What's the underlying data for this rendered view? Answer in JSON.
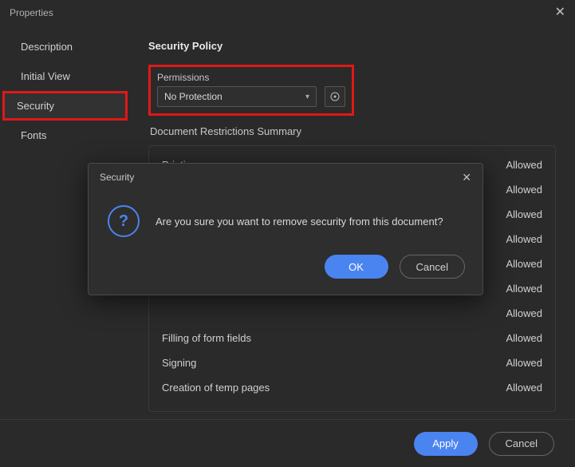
{
  "window": {
    "title": "Properties"
  },
  "sidebar": {
    "items": [
      {
        "label": "Description"
      },
      {
        "label": "Initial View"
      },
      {
        "label": "Security"
      },
      {
        "label": "Fonts"
      }
    ]
  },
  "security": {
    "title": "Security Policy",
    "permissions_label": "Permissions",
    "permissions_value": "No Protection",
    "summary_title": "Document Restrictions Summary",
    "rows": [
      {
        "label": "Printing",
        "status": "Allowed"
      },
      {
        "label": "",
        "status": "Allowed"
      },
      {
        "label": "",
        "status": "Allowed"
      },
      {
        "label": "",
        "status": "Allowed"
      },
      {
        "label": "",
        "status": "Allowed"
      },
      {
        "label": "",
        "status": "Allowed"
      },
      {
        "label": "",
        "status": "Allowed"
      },
      {
        "label": "Filling of form fields",
        "status": "Allowed"
      },
      {
        "label": "Signing",
        "status": "Allowed"
      },
      {
        "label": "Creation of temp pages",
        "status": "Allowed"
      }
    ]
  },
  "modal": {
    "title": "Security",
    "message": "Are you sure you want to remove security from this document?",
    "ok": "OK",
    "cancel": "Cancel"
  },
  "footer": {
    "apply": "Apply",
    "cancel": "Cancel"
  }
}
